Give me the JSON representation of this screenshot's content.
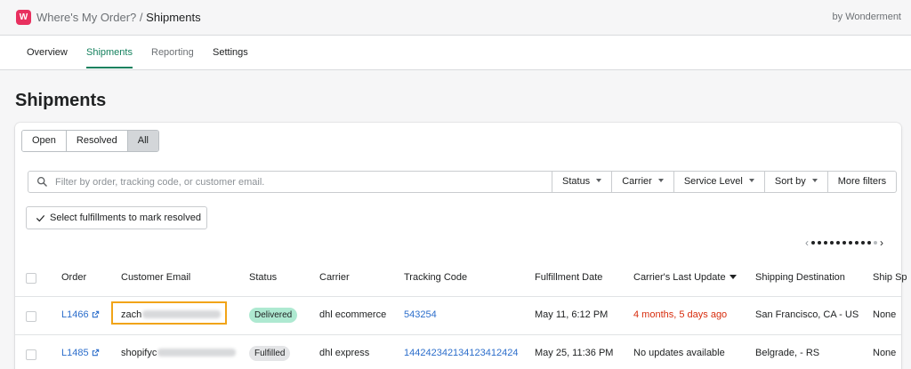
{
  "app": {
    "name": "Where's My Order?",
    "separator": "/",
    "section": "Shipments",
    "byline": "by Wonderment",
    "logo_letter": "W",
    "brand_color": "#e8305f"
  },
  "tabs": [
    {
      "label": "Overview",
      "active": false
    },
    {
      "label": "Shipments",
      "active": true
    },
    {
      "label": "Reporting",
      "active": false
    },
    {
      "label": "Settings",
      "active": false
    }
  ],
  "page_title": "Shipments",
  "segments": [
    "Open",
    "Resolved",
    "All"
  ],
  "selected_segment": "All",
  "search": {
    "placeholder": "Filter by order, tracking code, or customer email.",
    "icon": "search-icon"
  },
  "filters": [
    "Status",
    "Carrier",
    "Service Level",
    "Sort by",
    "More filters"
  ],
  "resolve_button": "Select fulfillments to mark resolved",
  "columns": [
    "Order",
    "Customer Email",
    "Status",
    "Carrier",
    "Tracking Code",
    "Fulfillment Date",
    "Carrier's Last Update",
    "Shipping Destination",
    "Ship Sp"
  ],
  "rows": [
    {
      "order": "L1466",
      "email_visible": "zach",
      "status": "Delivered",
      "carrier": "dhl ecommerce",
      "tracking": "543254",
      "fulfillment_date": "May 11, 6:12 PM",
      "last_update": "4 months, 5 days ago",
      "destination": "San Francisco, CA - US",
      "ship_speed": "None"
    },
    {
      "order": "L1485",
      "email_visible": "shopifyc",
      "status": "Fulfilled",
      "carrier": "dhl express",
      "tracking": "14424234213412341242​4",
      "fulfillment_date": "May 25, 11:36 PM",
      "last_update": "No updates available",
      "destination": "Belgrade, - RS",
      "ship_speed": "None"
    }
  ],
  "colors": {
    "accent": "#15815e",
    "link": "#2c6ecb",
    "alert": "#d72c0d",
    "delivered_badge": "#aee9d1",
    "fulfilled_badge": "#e4e5e7",
    "highlight": "#f1a418"
  }
}
